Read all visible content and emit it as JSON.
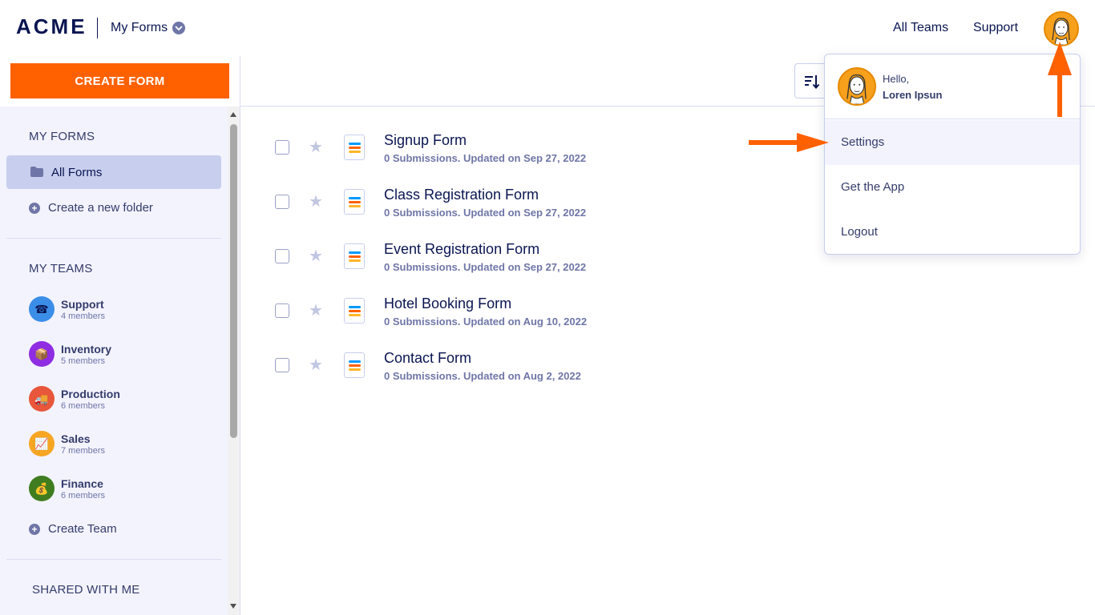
{
  "header": {
    "logo": "ACME",
    "title": "My Forms",
    "nav": [
      "All Teams",
      "Support"
    ]
  },
  "sidebar": {
    "create_button": "CREATE FORM",
    "my_forms_title": "MY FORMS",
    "all_forms": "All Forms",
    "create_folder": "Create a new folder",
    "my_teams_title": "MY TEAMS",
    "teams": [
      {
        "name": "Support",
        "members": "4 members",
        "color": "#3b8ee8",
        "icon": "☎"
      },
      {
        "name": "Inventory",
        "members": "5 members",
        "color": "#8e2de2",
        "icon": "📦"
      },
      {
        "name": "Production",
        "members": "6 members",
        "color": "#e8563b",
        "icon": "🚚"
      },
      {
        "name": "Sales",
        "members": "7 members",
        "color": "#f6a623",
        "icon": "📈"
      },
      {
        "name": "Finance",
        "members": "6 members",
        "color": "#3f7d20",
        "icon": "💰"
      }
    ],
    "create_team": "Create Team",
    "shared_title": "SHARED WITH ME"
  },
  "forms": [
    {
      "title": "Signup Form",
      "meta": "0 Submissions. Updated on Sep 27, 2022"
    },
    {
      "title": "Class Registration Form",
      "meta": "0 Submissions. Updated on Sep 27, 2022"
    },
    {
      "title": "Event Registration Form",
      "meta": "0 Submissions. Updated on Sep 27, 2022"
    },
    {
      "title": "Hotel Booking Form",
      "meta": "0 Submissions. Updated on Aug 10, 2022"
    },
    {
      "title": "Contact Form",
      "meta": "0 Submissions. Updated on Aug 2, 2022"
    }
  ],
  "dropdown": {
    "hello": "Hello,",
    "user_name": "Loren Ipsun",
    "items": [
      "Settings",
      "Get the App",
      "Logout"
    ]
  },
  "colors": {
    "accent": "#ff6100",
    "navy": "#0a1551",
    "sidebar_bg": "#f3f3fe",
    "selected_bg": "#c8ceed"
  }
}
